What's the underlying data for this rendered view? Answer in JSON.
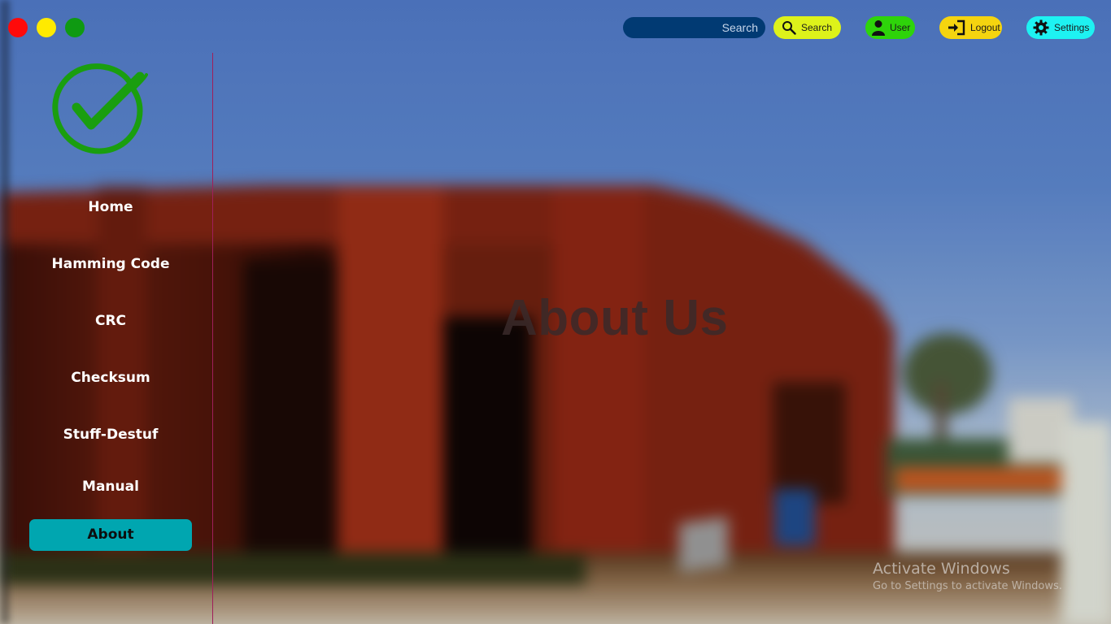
{
  "window_controls": {
    "colors": {
      "close": "#ff0a0a",
      "minimize": "#ffea00",
      "maximize": "#0f9a12"
    }
  },
  "header": {
    "search": {
      "placeholder": "Search"
    },
    "search_button": {
      "label": "Search",
      "icon": "magnifier-icon",
      "color": "#ddf21a"
    },
    "user_button": {
      "label": "User",
      "icon": "person-icon",
      "color": "#2ed40a"
    },
    "logout_button": {
      "label": "Logout",
      "icon": "sign-in-arrow-icon",
      "color": "#f5d40f"
    },
    "settings_button": {
      "label": "Settings",
      "icon": "gear-icon",
      "color": "#1ef2f2"
    }
  },
  "sidebar": {
    "logo": {
      "icon": "green-checkmark-circle-icon",
      "color": "#1a9e0f"
    },
    "items": [
      {
        "label": "Home",
        "active": false
      },
      {
        "label": "Hamming Code",
        "active": false
      },
      {
        "label": "CRC",
        "active": false
      },
      {
        "label": "Checksum",
        "active": false
      },
      {
        "label": "Stuff-Destuf",
        "active": false
      },
      {
        "label": "Manual",
        "active": false
      },
      {
        "label": "About",
        "active": true
      }
    ],
    "active_color": "#00a6b0",
    "divider_color": "#a01f5a"
  },
  "main": {
    "heading": "About Us"
  },
  "watermark": {
    "title": "Activate Windows",
    "subtitle": "Go to Settings to activate Windows."
  }
}
